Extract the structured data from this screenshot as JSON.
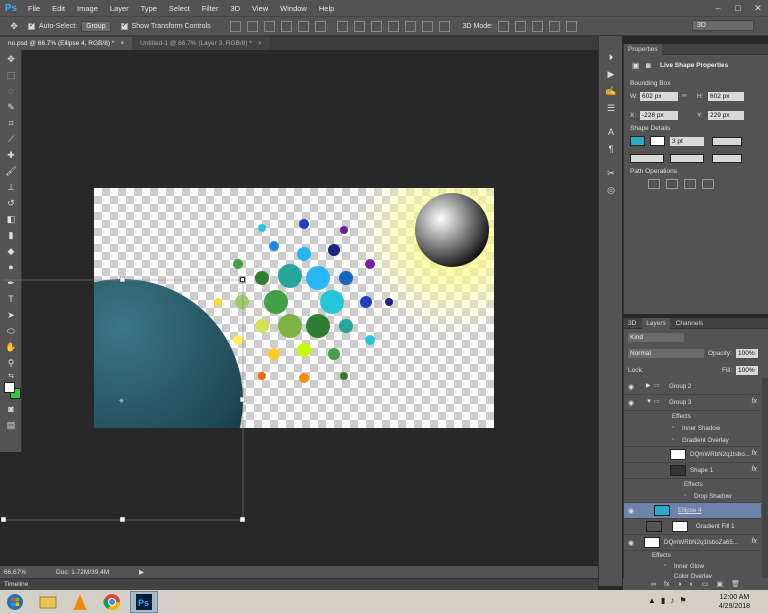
{
  "app": {
    "logo": "Ps"
  },
  "menu": [
    "File",
    "Edit",
    "Image",
    "Layer",
    "Type",
    "Select",
    "Filter",
    "3D",
    "View",
    "Window",
    "Help"
  ],
  "window_controls": [
    "–",
    "□",
    "✕"
  ],
  "options": {
    "auto_select_label": "Auto-Select:",
    "auto_select_value": "Group",
    "show_transform_label": "Show Transform Controls",
    "mode_label": "3D Mode:",
    "workspace": "3D"
  },
  "tabs": [
    {
      "label": "no.psd @ 66.7% (Ellipse 4, RGB/8) *",
      "close": "×"
    },
    {
      "label": "Untitled-1 @ 66.7% (Layer 3, RGB/8) *",
      "close": "×"
    }
  ],
  "tools": [
    "move-tool",
    "marquee-tool",
    "lasso-tool",
    "quick-select-tool",
    "crop-tool",
    "eyedropper-tool",
    "healing-tool",
    "brush-tool",
    "stamp-tool",
    "history-brush-tool",
    "eraser-tool",
    "gradient-tool",
    "blur-tool",
    "dodge-tool",
    "pen-tool",
    "type-tool",
    "path-select-tool",
    "shape-tool",
    "hand-tool",
    "zoom-tool"
  ],
  "colors": {
    "foreground": "#ffffff",
    "background": "#33cc33",
    "accent": "#3fa9f5",
    "selected_layer": "#6d84a8"
  },
  "status": {
    "zoom": "66.67%",
    "doc": "Doc: 1.72M/39.4M"
  },
  "timeline": "Timeline",
  "properties": {
    "tab": "Properties",
    "title": "Live Shape Properties",
    "bounding_box": "Bounding Box",
    "w_label": "W:",
    "w": "602 px",
    "h_label": "H:",
    "h": "602 px",
    "x_label": "X:",
    "x": "-228 px",
    "y_label": "Y:",
    "y": "229 px",
    "shape_details": "Shape Details",
    "stroke_width": "3 pt",
    "path_ops": "Path Operations",
    "fill_color": "#2ea8c9"
  },
  "layers_panel": {
    "tabs": [
      "3D",
      "Layers",
      "Channels"
    ],
    "kind": "Kind",
    "blend": "Normal",
    "opacity_label": "Opacity:",
    "opacity": "100%",
    "lock_label": "Lock:",
    "fill_label": "Fill:",
    "fill": "100%",
    "rows": [
      {
        "name": "Group 2"
      },
      {
        "name": "Group 3"
      },
      {
        "name": "Effects"
      },
      {
        "name": "Inner Shadow"
      },
      {
        "name": "Gradient Overlay"
      },
      {
        "name": "DQmWRbN2q1tsbo..."
      },
      {
        "name": "Shape 1"
      },
      {
        "name": "Effects"
      },
      {
        "name": "Drop Shadow"
      },
      {
        "name": "Ellipse 4"
      },
      {
        "name": "Gradient Fill 1"
      },
      {
        "name": "DQmWRbN2q1tsboZa65..."
      },
      {
        "name": "Effects"
      },
      {
        "name": "Inner Glow"
      },
      {
        "name": "Color Overlay"
      }
    ],
    "footer": [
      "∞",
      "fx",
      "◑",
      "◐",
      "▭",
      "▣",
      "🗑"
    ]
  },
  "taskbar": {
    "apps": [
      "start",
      "file-explorer",
      "vlc",
      "chrome",
      "photoshop"
    ],
    "time": "12:00 AM",
    "date": "4/29/2018"
  }
}
